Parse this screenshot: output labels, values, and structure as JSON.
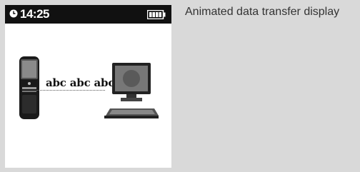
{
  "status_bar": {
    "time": "14:25",
    "clock_icon": "clock-icon",
    "battery_icon": "battery-icon"
  },
  "caption": "Animated data transfer display",
  "transfer": {
    "text": "abc abc abc",
    "source_icon": "mobile-phone-icon",
    "target_icon": "desktop-computer-icon"
  },
  "colors": {
    "status_bar_bg": "#111111",
    "screen_bg": "#ffffff",
    "page_bg": "#d9d9d9"
  }
}
